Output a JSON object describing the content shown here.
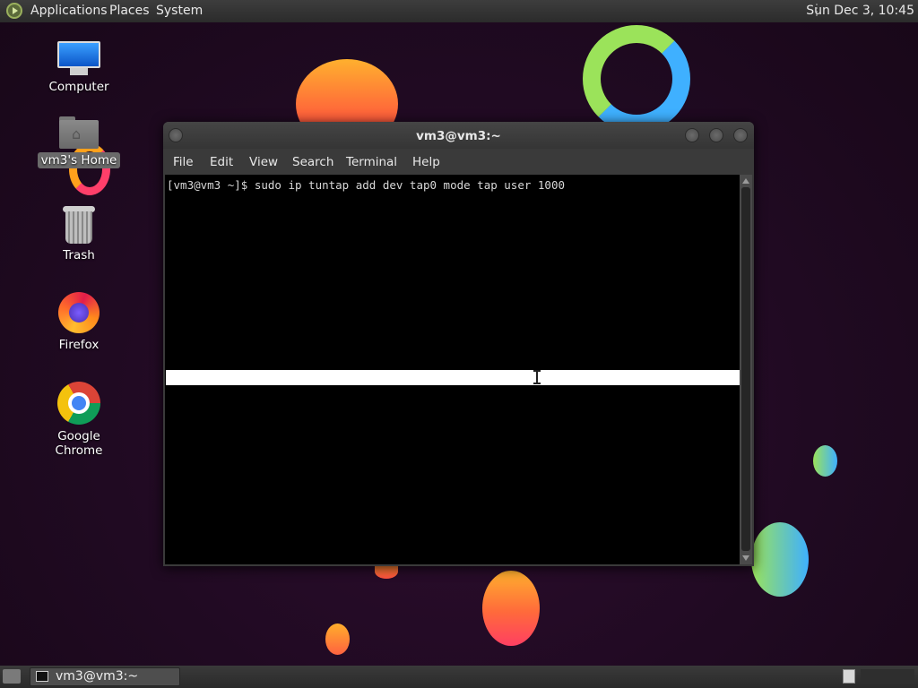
{
  "top_panel": {
    "menus": [
      "Applications",
      "Places",
      "System"
    ],
    "clock": "Sun Dec 3, 10:45"
  },
  "desktop": {
    "icons": [
      {
        "label": "Computer",
        "icon": "computer-icon"
      },
      {
        "label": "vm3's Home",
        "icon": "home-folder-icon"
      },
      {
        "label": "Trash",
        "icon": "trash-icon"
      },
      {
        "label": "Firefox",
        "icon": "firefox-icon"
      },
      {
        "label": "Google Chrome",
        "icon": "chrome-icon"
      }
    ]
  },
  "terminal": {
    "title": "vm3@vm3:~",
    "menus": [
      "File",
      "Edit",
      "View",
      "Search",
      "Terminal",
      "Help"
    ],
    "prompt_line": "[vm3@vm3 ~]$ sudo ip tuntap add dev tap0 mode tap user 1000"
  },
  "bottom_panel": {
    "task_label": "vm3@vm3:~"
  },
  "colors": {
    "background": "#200a22",
    "panel": "#333333",
    "terminal_bg": "#000000",
    "terminal_text": "#d8d8d8"
  }
}
